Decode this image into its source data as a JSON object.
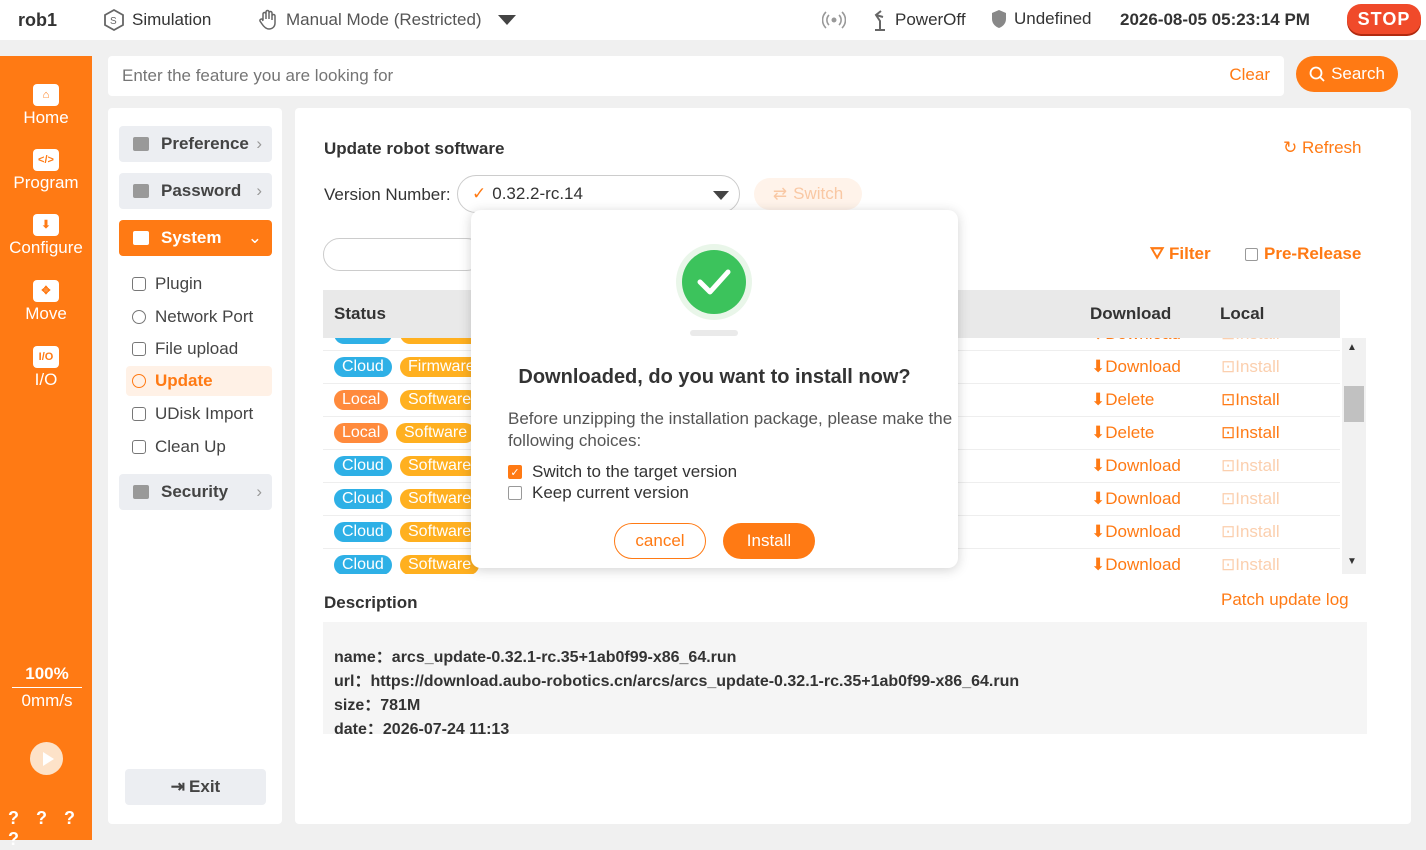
{
  "topbar": {
    "robot": "rob1",
    "mode_sim": "Simulation",
    "mode_manual": "Manual Mode (Restricted)",
    "power": "PowerOff",
    "safety": "Undefined",
    "datetime": "2026-08-05 05:23:14 PM",
    "stop": "STOP"
  },
  "sidebar": {
    "items": [
      {
        "label": "Home",
        "icon": "home-icon"
      },
      {
        "label": "Program",
        "icon": "code-icon"
      },
      {
        "label": "Configure",
        "icon": "download-box-icon"
      },
      {
        "label": "Move",
        "icon": "move-arrows-icon"
      },
      {
        "label": "I/O",
        "icon": "io-icon"
      }
    ],
    "speed_pct": "100%",
    "speed_mm": "0mm/s",
    "help": "? ? ? ?"
  },
  "search": {
    "placeholder": "Enter the feature you are looking for",
    "clear": "Clear",
    "button": "Search"
  },
  "menu": {
    "preference": "Preference",
    "password": "Password",
    "system": "System",
    "sub": [
      "Plugin",
      "Network Port",
      "File upload",
      "Update",
      "UDisk Import",
      "Clean Up"
    ],
    "security": "Security",
    "exit": "Exit"
  },
  "main": {
    "title": "Update robot software",
    "refresh": "Refresh",
    "version_label": "Version Number:",
    "version_value": "0.32.2-rc.14",
    "switch": "Switch",
    "filter": "Filter",
    "prerelease": "Pre-Release",
    "col_status": "Status",
    "col_download": "Download",
    "col_local": "Local",
    "rows": [
      {
        "t1": "Cloud",
        "t2": "Firmware",
        "a": "Download",
        "b": "Install",
        "b_enabled": false
      },
      {
        "t1": "Local",
        "t2": "Software",
        "a": "Delete",
        "b": "Install",
        "b_enabled": true
      },
      {
        "t1": "Local",
        "t2": "Software",
        "a": "Delete",
        "b": "Install",
        "b_enabled": true
      },
      {
        "t1": "Cloud",
        "t2": "Software",
        "a": "Download",
        "b": "Install",
        "b_enabled": false
      },
      {
        "t1": "Cloud",
        "t2": "Software",
        "a": "Download",
        "b": "Install",
        "b_enabled": false
      },
      {
        "t1": "Cloud",
        "t2": "Software",
        "a": "Download",
        "b": "Install",
        "b_enabled": false
      },
      {
        "t1": "Cloud",
        "t2": "Software",
        "a": "Download",
        "b": "Install",
        "b_enabled": false
      }
    ],
    "description_title": "Description",
    "patch_log": "Patch update log",
    "desc": {
      "name": "name：arcs_update-0.32.1-rc.35+1ab0f99-x86_64.run",
      "url": "url：https://download.aubo-robotics.cn/arcs/arcs_update-0.32.1-rc.35+1ab0f99-x86_64.run",
      "size": "size：781M",
      "date": "date：2026-07-24 11:13"
    }
  },
  "modal": {
    "heading": "Downloaded, do you want to install now?",
    "body": "Before unzipping the installation package, please make the following choices:",
    "opt1": "Switch to the target version",
    "opt1_checked": true,
    "opt2": "Keep current version",
    "opt2_checked": false,
    "cancel": "cancel",
    "install": "Install"
  },
  "colors": {
    "accent": "#ff7a14",
    "cloud": "#2eb0e6",
    "software": "#ffb020",
    "success": "#3cc35c"
  }
}
